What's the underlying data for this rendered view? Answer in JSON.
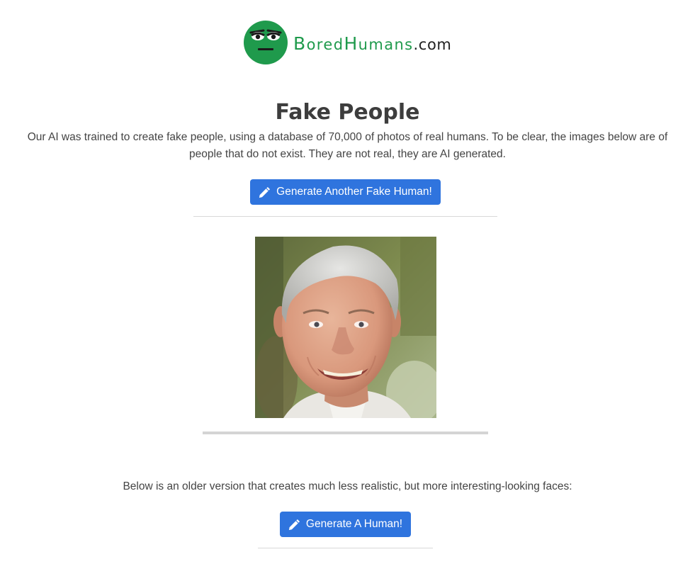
{
  "logo": {
    "word_1_initial": "B",
    "word_1_rest": "ored",
    "word_2_initial": "H",
    "word_2_rest": "umans",
    "tld": ".com",
    "icon": "bored-face-icon",
    "brand_color": "#1f9a4c"
  },
  "page": {
    "title": "Fake People",
    "intro": "Our AI was trained to create fake people, using a database of 70,000 of photos of real humans. To be clear, the images below are of people that do not exist. They are not real, they are AI generated."
  },
  "generator": {
    "button_label": "Generate Another Fake Human!",
    "button_icon": "pencil-icon",
    "button_color": "#2f74de"
  },
  "older_version": {
    "text": "Below is an older version that creates much less realistic, but more interesting-looking faces:",
    "button_label": "Generate A Human!",
    "button_icon": "pencil-icon"
  }
}
